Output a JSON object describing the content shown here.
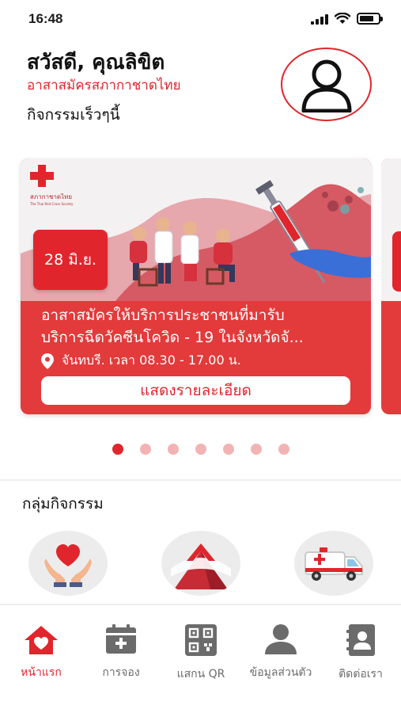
{
  "status_bar": {
    "time": "16:48"
  },
  "header": {
    "greeting": "สวัสดี, คุณลิขิต",
    "organization": "อาสาสมัครสภากาชาดไทย",
    "section_recent": "กิจกรรมเร็วๆนี้"
  },
  "activity_card": {
    "date": "28 มิ.ย.",
    "title_line1": "อาสาสมัครให้บริการประชาชนที่มารับ",
    "title_line2": "บริการฉีดวัคซีนโควิด - 19 ในจังหวัดจั...",
    "location": "จันทบรี. เวลา 08.30 - 17.00 น.",
    "detail_button": "แสดงรายละเอียด",
    "logo_text": "สภากาชาดไทย",
    "logo_subtext": "The Thai Red Cross Society"
  },
  "carousel": {
    "count": 7,
    "active_index": 0
  },
  "groups": {
    "title": "กลุ่มกิจกรรม",
    "items": [
      {
        "icon": "heart-in-hands-icon"
      },
      {
        "icon": "shelter-icon"
      },
      {
        "icon": "ambulance-icon"
      }
    ]
  },
  "tabbar": {
    "items": [
      {
        "label": "หน้าแรก",
        "icon": "home-heart-icon",
        "active": true
      },
      {
        "label": "การจอง",
        "icon": "calendar-add-icon",
        "active": false
      },
      {
        "label": "แสกน QR",
        "icon": "qr-code-icon",
        "active": false
      },
      {
        "label": "ข้อมูลส่วนตัว",
        "icon": "profile-icon",
        "active": false
      },
      {
        "label": "ติดต่อเรา",
        "icon": "contact-book-icon",
        "active": false
      }
    ]
  },
  "colors": {
    "accent": "#e0262c",
    "card": "#e33a3b",
    "inactive": "#6b6b6b"
  }
}
